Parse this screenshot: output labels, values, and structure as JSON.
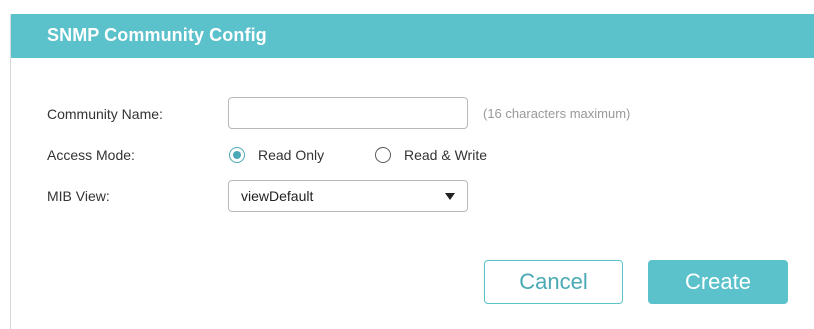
{
  "dialog": {
    "title": "SNMP Community Config"
  },
  "form": {
    "community_name": {
      "label": "Community Name:",
      "value": "",
      "placeholder": "",
      "hint": "(16 characters maximum)"
    },
    "access_mode": {
      "label": "Access Mode:",
      "options": [
        "Read Only",
        "Read & Write"
      ],
      "selected": "Read Only"
    },
    "mib_view": {
      "label": "MIB View:",
      "selected": "viewDefault"
    }
  },
  "buttons": {
    "cancel": "Cancel",
    "create": "Create"
  },
  "colors": {
    "accent": "#5bc1cb",
    "accent_dark": "#4aa9b4"
  }
}
